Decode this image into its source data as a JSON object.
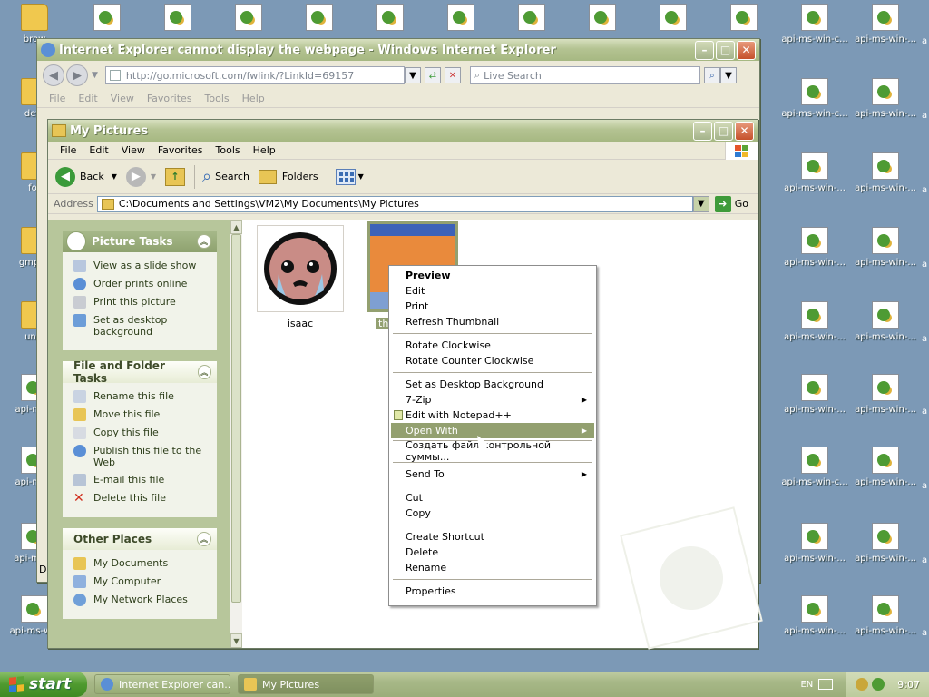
{
  "desktop": {
    "left_labels": [
      "brow",
      "defa",
      "for",
      "gmp-cl",
      "unin",
      "api-ms-v",
      "api-ms-v",
      "api-ms-w",
      "api-ms-win"
    ],
    "col_label_a": "api-ms-win-c...",
    "col_label_b": "api-ms-win-...",
    "edge_label": "a",
    "partial_label": "D"
  },
  "ie": {
    "title": "Internet Explorer cannot display the webpage - Windows Internet Explorer",
    "url": "http://go.microsoft.com/fwlink/?LinkId=69157",
    "search_placeholder": "Live Search",
    "menu": [
      "File",
      "Edit",
      "View",
      "Favorites",
      "Tools",
      "Help"
    ]
  },
  "explorer": {
    "title": "My Pictures",
    "menu": [
      "File",
      "Edit",
      "View",
      "Favorites",
      "Tools",
      "Help"
    ],
    "toolbar": {
      "back": "Back",
      "search": "Search",
      "folders": "Folders"
    },
    "address_label": "Address",
    "address_value": "C:\\Documents and Settings\\VM2\\My Documents\\My Pictures",
    "go_label": "Go",
    "picture_tasks": {
      "title": "Picture Tasks",
      "items": [
        "View as a slide show",
        "Order prints online",
        "Print this picture",
        "Set as desktop background"
      ]
    },
    "file_tasks": {
      "title": "File and Folder Tasks",
      "items": [
        "Rename this file",
        "Move this file",
        "Copy this file",
        "Publish this file to the Web",
        "E-mail this file",
        "Delete this file"
      ]
    },
    "other_places": {
      "title": "Other Places",
      "items": [
        "My Documents",
        "My Computer",
        "My Network Places"
      ]
    },
    "files": [
      {
        "name": "isaac"
      },
      {
        "name": "th"
      }
    ]
  },
  "context_menu": {
    "items": [
      "Preview",
      "Edit",
      "Print",
      "Refresh Thumbnail",
      "Rotate Clockwise",
      "Rotate Counter Clockwise",
      "Set as Desktop Background",
      "7-Zip",
      "Edit with Notepad++",
      "Open With",
      "Создать файл контрольной суммы...",
      "Send To",
      "Cut",
      "Copy",
      "Create Shortcut",
      "Delete",
      "Rename",
      "Properties"
    ]
  },
  "taskbar": {
    "start": "start",
    "tasks": [
      "Internet Explorer can...",
      "My Pictures"
    ],
    "lang": "EN",
    "clock": "9:07"
  }
}
